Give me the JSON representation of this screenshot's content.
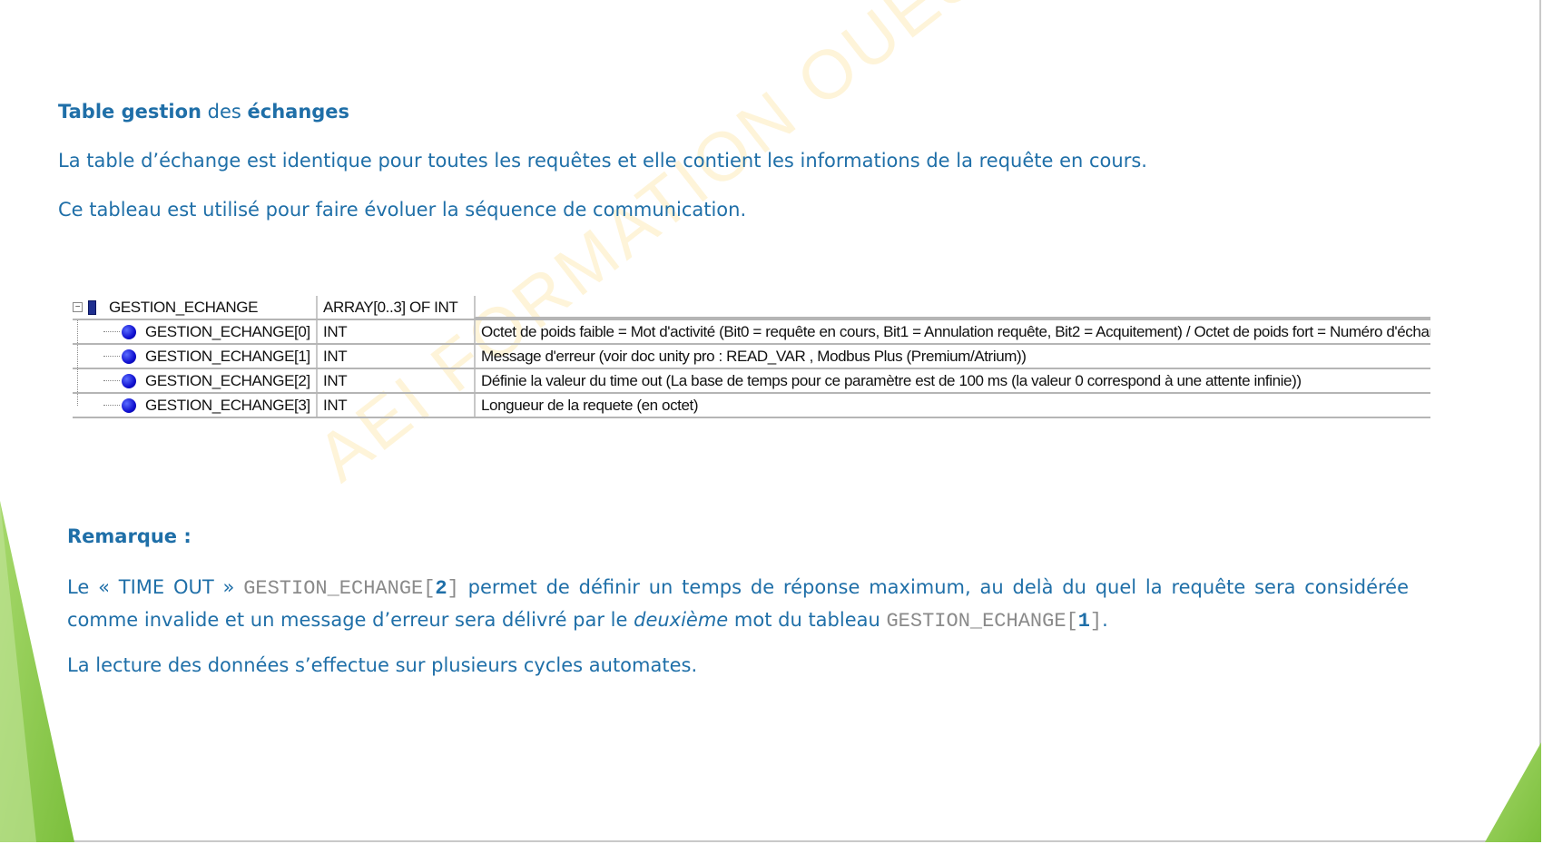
{
  "heading": {
    "part1": "Table gestion",
    "part2": " des ",
    "part3": "échanges"
  },
  "paragraph1": "La table d’échange est identique pour toutes les requêtes et elle contient les informations de la requête en cours.",
  "paragraph2": "Ce tableau est utilisé pour faire évoluer la séquence de communication.",
  "variable_table": {
    "parent": {
      "name": "GESTION_ECHANGE",
      "type": "ARRAY[0..3] OF INT",
      "comment": ""
    },
    "rows": [
      {
        "name": "GESTION_ECHANGE[0]",
        "type": "INT",
        "comment": "Octet de poids faible = Mot d'activité (Bit0 = requête en cours, Bit1 = Annulation requête, Bit2 = Acquitement) / Octet de poids fort = Numéro d'échange"
      },
      {
        "name": "GESTION_ECHANGE[1]",
        "type": "INT",
        "comment": "Message d'erreur (voir doc unity pro : READ_VAR , Modbus Plus (Premium/Atrium))"
      },
      {
        "name": "GESTION_ECHANGE[2]",
        "type": "INT",
        "comment": "Définie la valeur du time out (La base de temps pour ce paramètre est de 100 ms (la valeur 0 correspond à une attente infinie))"
      },
      {
        "name": "GESTION_ECHANGE[3]",
        "type": "INT",
        "comment": "Longueur de la requete (en octet)"
      }
    ]
  },
  "remark": {
    "title": "Remarque :",
    "body_1": "Le « TIME OUT » ",
    "code_1_prefix": "GESTION_ECHANGE[",
    "code_1_index": "2",
    "code_1_suffix": "]",
    "body_2": " permet de définir un temps de réponse maximum, au delà du quel la requête sera considérée comme invalide et un message d’erreur sera délivré par le ",
    "body_emph": "deuxième",
    "body_3": " mot du tableau ",
    "code_2_prefix": "GESTION_ECHANGE[",
    "code_2_index": "1",
    "code_2_suffix": "]",
    "body_4": "."
  },
  "paragraph3": "La lecture des données s’effectue sur plusieurs cycles automates.",
  "watermark": "AEI FORMATION OUEST",
  "colors": {
    "text": "#1f6fa8",
    "accent_green": "#8cc63f",
    "code_gray": "#8a8a8a"
  }
}
